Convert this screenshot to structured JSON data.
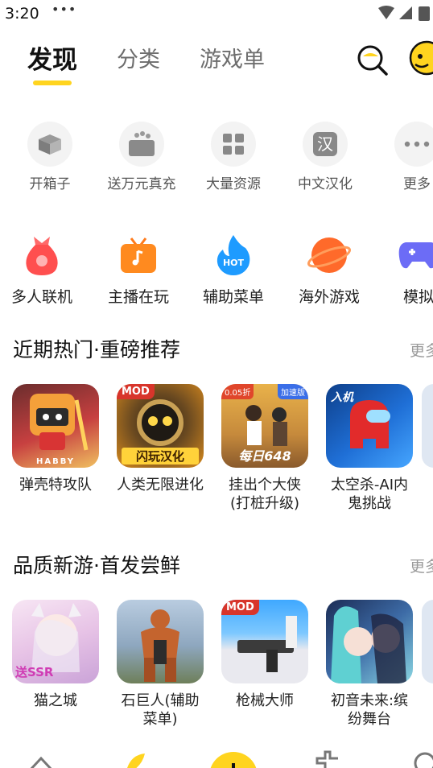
{
  "status": {
    "time": "3:20",
    "dots": "•••"
  },
  "tabs": [
    {
      "label": "发现",
      "active": true
    },
    {
      "label": "分类",
      "active": false
    },
    {
      "label": "游戏单",
      "active": false
    }
  ],
  "quick_row1": [
    {
      "label": "开箱子",
      "icon": "open-box-icon"
    },
    {
      "label": "送万元真充",
      "icon": "gift-recharge-icon",
      "badge": "送万元"
    },
    {
      "label": "大量资源",
      "icon": "resources-grid-icon"
    },
    {
      "label": "中文汉化",
      "icon": "chinese-han-icon",
      "glyph": "汉"
    },
    {
      "label": "更多",
      "icon": "more-dots-icon"
    }
  ],
  "quick_row2": [
    {
      "label": "多人联机",
      "icon": "money-bag-icon"
    },
    {
      "label": "主播在玩",
      "icon": "tv-streamer-icon"
    },
    {
      "label": "辅助菜单",
      "icon": "hot-flame-icon",
      "badge": "HOT"
    },
    {
      "label": "海外游戏",
      "icon": "planet-icon"
    },
    {
      "label": "模拟",
      "icon": "gamepad-icon"
    }
  ],
  "section_hot": {
    "title": "近期热门·重磅推荐",
    "more": "更多",
    "games": [
      {
        "name": "弹壳特攻队",
        "cover_text": "HABBY"
      },
      {
        "name": "人类无限进化",
        "badge": "MOD",
        "cover_text": "闪玩汉化"
      },
      {
        "name": "挂出个大侠(打桩升级)",
        "badge": "0.05折",
        "badge2": "加速版",
        "cover_text": "每日648"
      },
      {
        "name": "太空杀-AI内鬼挑战",
        "cover_text": "入机"
      }
    ]
  },
  "section_new": {
    "title": "品质新游·首发尝鲜",
    "more": "更多",
    "games": [
      {
        "name": "猫之城",
        "cover_text": "送SSR"
      },
      {
        "name": "石巨人(辅助菜单)"
      },
      {
        "name": "枪械大师",
        "badge": "MOD"
      },
      {
        "name": "初音未来:缤纷舞台"
      }
    ]
  },
  "colors": {
    "accent": "#ffd41f",
    "text": "#222222",
    "muted": "#9a9a9a"
  }
}
